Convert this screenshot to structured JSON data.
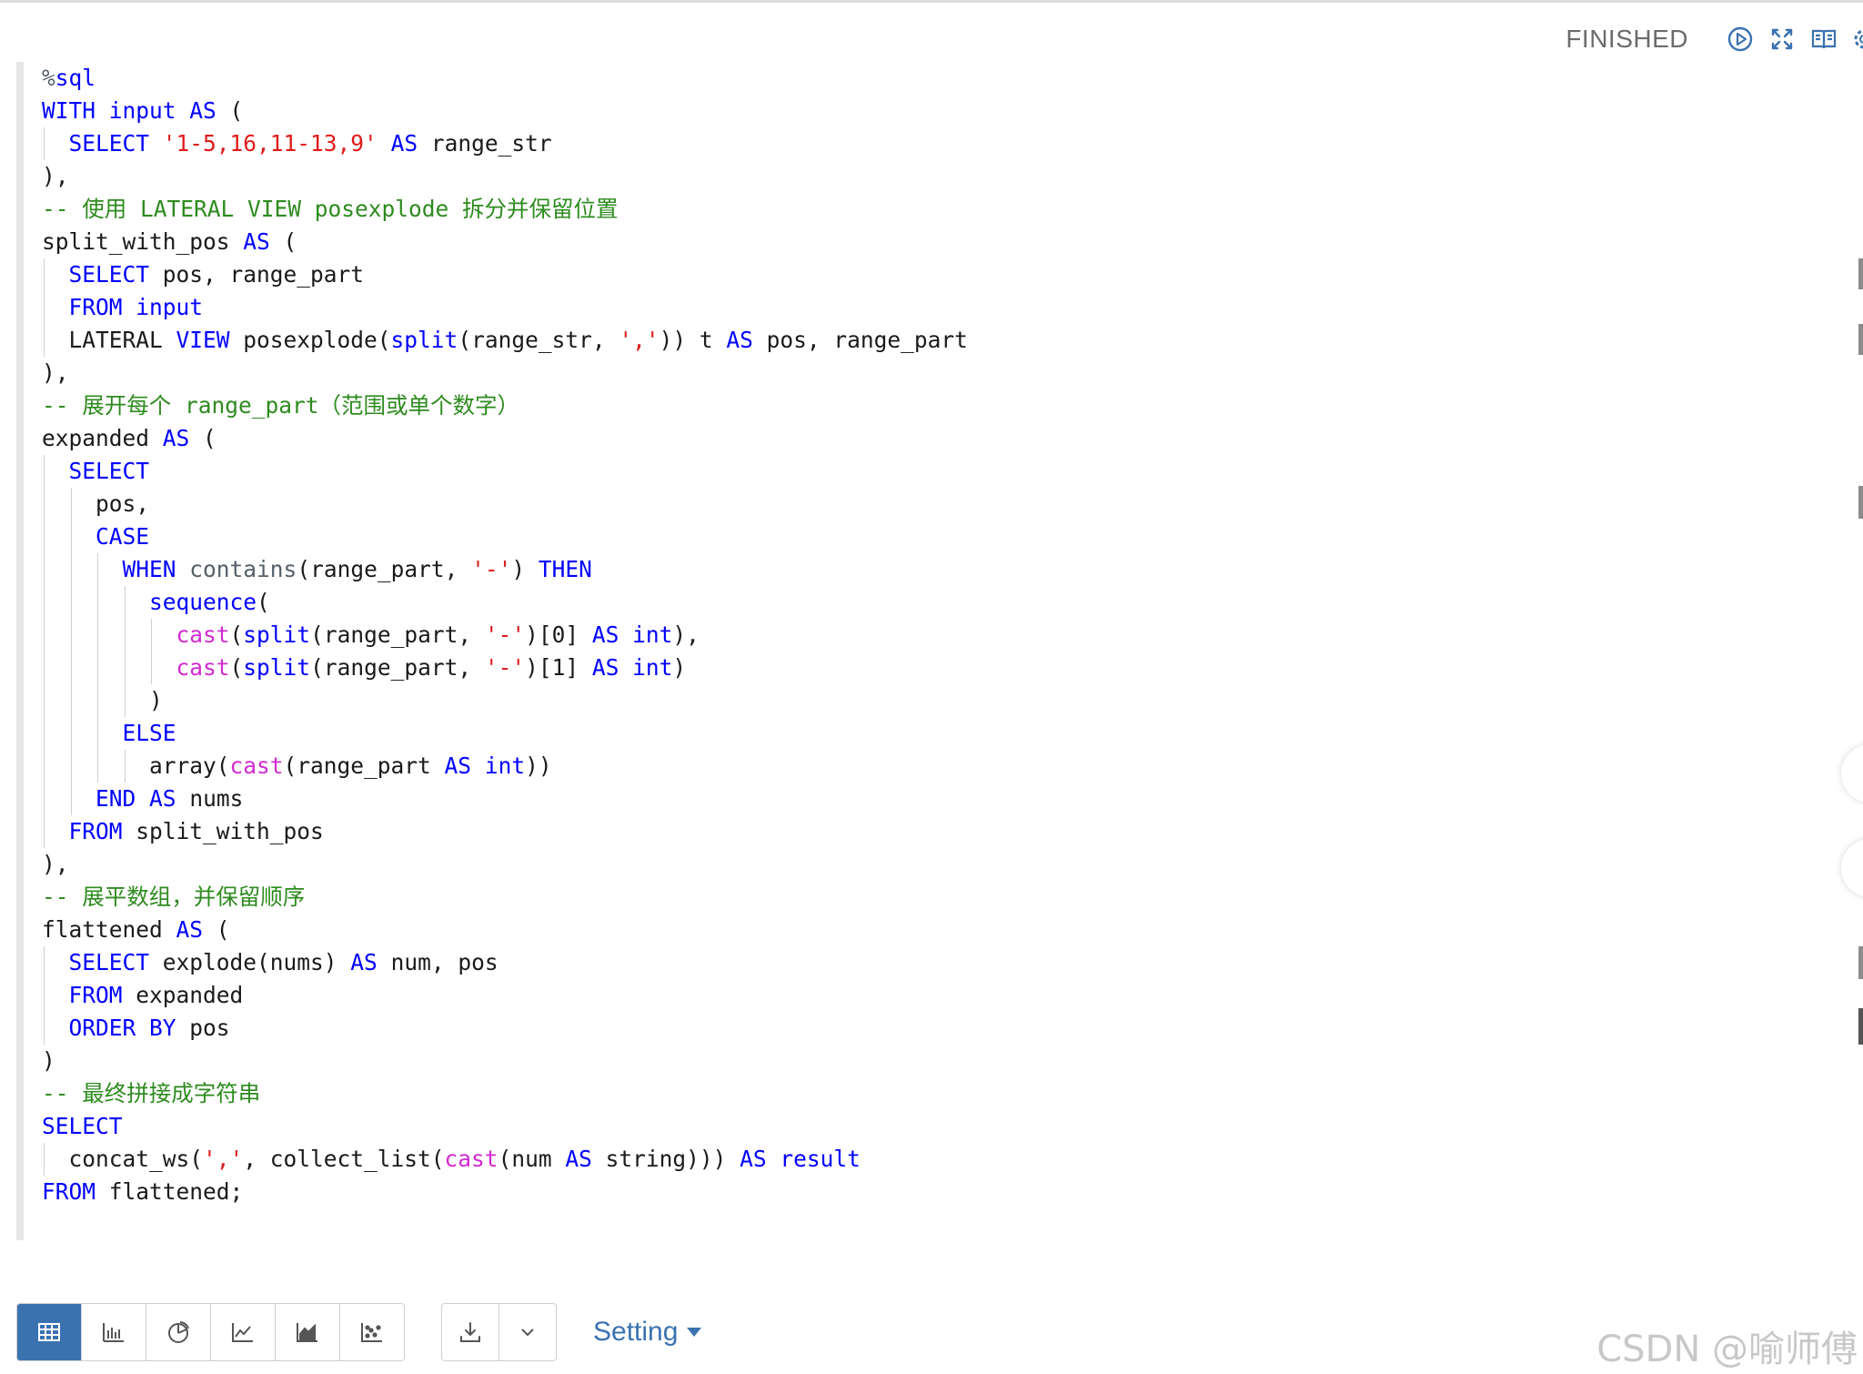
{
  "paragraph": {
    "status": "FINISHED",
    "header_icons": [
      "run-icon",
      "expand-icon",
      "book-icon",
      "settings-icon"
    ]
  },
  "code_lines": [
    [
      {
        "t": "%",
        "c": "gr"
      },
      {
        "t": "sql",
        "c": "kw"
      }
    ],
    [
      {
        "t": "WITH input AS",
        "c": "kw"
      },
      {
        "t": " ("
      }
    ],
    [
      {
        "t": "  "
      },
      {
        "t": "SELECT",
        "c": "kw"
      },
      {
        "t": " "
      },
      {
        "t": "'1-5,16,11-13,9'",
        "c": "str"
      },
      {
        "t": " "
      },
      {
        "t": "AS",
        "c": "kw"
      },
      {
        "t": " range_str"
      }
    ],
    [
      {
        "t": "),"
      }
    ],
    [
      {
        "t": "-- 使用 LATERAL VIEW posexplode 拆分并保留位置",
        "c": "cm"
      }
    ],
    [
      {
        "t": "split_with_pos "
      },
      {
        "t": "AS",
        "c": "kw"
      },
      {
        "t": " ("
      }
    ],
    [
      {
        "t": "  "
      },
      {
        "t": "SELECT",
        "c": "kw"
      },
      {
        "t": " pos, range_part"
      }
    ],
    [
      {
        "t": "  "
      },
      {
        "t": "FROM input",
        "c": "kw"
      }
    ],
    [
      {
        "t": "  LATERAL "
      },
      {
        "t": "VIEW",
        "c": "kw"
      },
      {
        "t": " posexplode("
      },
      {
        "t": "split",
        "c": "kw"
      },
      {
        "t": "(range_str, "
      },
      {
        "t": "','",
        "c": "str"
      },
      {
        "t": ")) t "
      },
      {
        "t": "AS",
        "c": "kw"
      },
      {
        "t": " pos, range_part"
      }
    ],
    [
      {
        "t": "),"
      }
    ],
    [
      {
        "t": "-- 展开每个 range_part（范围或单个数字）",
        "c": "cm"
      }
    ],
    [
      {
        "t": "expanded "
      },
      {
        "t": "AS",
        "c": "kw"
      },
      {
        "t": " ("
      }
    ],
    [
      {
        "t": "  "
      },
      {
        "t": "SELECT",
        "c": "kw"
      }
    ],
    [
      {
        "t": "    pos,"
      }
    ],
    [
      {
        "t": "    "
      },
      {
        "t": "CASE",
        "c": "kw"
      }
    ],
    [
      {
        "t": "      "
      },
      {
        "t": "WHEN",
        "c": "kw"
      },
      {
        "t": " "
      },
      {
        "t": "contains",
        "c": "gr"
      },
      {
        "t": "(range_part, "
      },
      {
        "t": "'-'",
        "c": "str"
      },
      {
        "t": ") "
      },
      {
        "t": "THEN",
        "c": "kw"
      }
    ],
    [
      {
        "t": "        "
      },
      {
        "t": "sequence",
        "c": "kw"
      },
      {
        "t": "("
      }
    ],
    [
      {
        "t": "          "
      },
      {
        "t": "cast",
        "c": "fn"
      },
      {
        "t": "("
      },
      {
        "t": "split",
        "c": "kw"
      },
      {
        "t": "(range_part, "
      },
      {
        "t": "'-'",
        "c": "str"
      },
      {
        "t": ")[0] "
      },
      {
        "t": "AS",
        "c": "kw"
      },
      {
        "t": " "
      },
      {
        "t": "int",
        "c": "kw"
      },
      {
        "t": "),"
      }
    ],
    [
      {
        "t": "          "
      },
      {
        "t": "cast",
        "c": "fn"
      },
      {
        "t": "("
      },
      {
        "t": "split",
        "c": "kw"
      },
      {
        "t": "(range_part, "
      },
      {
        "t": "'-'",
        "c": "str"
      },
      {
        "t": ")[1] "
      },
      {
        "t": "AS",
        "c": "kw"
      },
      {
        "t": " "
      },
      {
        "t": "int",
        "c": "kw"
      },
      {
        "t": ")"
      }
    ],
    [
      {
        "t": "        )"
      }
    ],
    [
      {
        "t": "      "
      },
      {
        "t": "ELSE",
        "c": "kw"
      }
    ],
    [
      {
        "t": "        array("
      },
      {
        "t": "cast",
        "c": "fn"
      },
      {
        "t": "(range_part "
      },
      {
        "t": "AS",
        "c": "kw"
      },
      {
        "t": " "
      },
      {
        "t": "int",
        "c": "kw"
      },
      {
        "t": "))"
      }
    ],
    [
      {
        "t": "    "
      },
      {
        "t": "END",
        "c": "kw"
      },
      {
        "t": " "
      },
      {
        "t": "AS",
        "c": "kw"
      },
      {
        "t": " nums"
      }
    ],
    [
      {
        "t": "  "
      },
      {
        "t": "FROM",
        "c": "kw"
      },
      {
        "t": " split_with_pos"
      }
    ],
    [
      {
        "t": "),"
      }
    ],
    [
      {
        "t": "-- 展平数组，并保留顺序",
        "c": "cm"
      }
    ],
    [
      {
        "t": "flattened "
      },
      {
        "t": "AS",
        "c": "kw"
      },
      {
        "t": " ("
      }
    ],
    [
      {
        "t": "  "
      },
      {
        "t": "SELECT",
        "c": "kw"
      },
      {
        "t": " explode(nums) "
      },
      {
        "t": "AS",
        "c": "kw"
      },
      {
        "t": " num, pos"
      }
    ],
    [
      {
        "t": "  "
      },
      {
        "t": "FROM",
        "c": "kw"
      },
      {
        "t": " expanded"
      }
    ],
    [
      {
        "t": "  "
      },
      {
        "t": "ORDER BY",
        "c": "kw"
      },
      {
        "t": " pos"
      }
    ],
    [
      {
        "t": ")"
      }
    ],
    [
      {
        "t": "-- 最终拼接成字符串",
        "c": "cm"
      }
    ],
    [
      {
        "t": "SELECT",
        "c": "kw"
      }
    ],
    [
      {
        "t": "  concat_ws("
      },
      {
        "t": "','",
        "c": "str"
      },
      {
        "t": ", collect_list("
      },
      {
        "t": "cast",
        "c": "fn"
      },
      {
        "t": "(num "
      },
      {
        "t": "AS",
        "c": "kw"
      },
      {
        "t": " string))) "
      },
      {
        "t": "AS result",
        "c": "kw"
      }
    ],
    [
      {
        "t": "FROM",
        "c": "kw"
      },
      {
        "t": " flattened;"
      }
    ]
  ],
  "toolbar": {
    "view_buttons": [
      {
        "name": "table-view-button",
        "icon": "table-icon",
        "active": true
      },
      {
        "name": "bar-chart-button",
        "icon": "bar-chart-icon",
        "active": false
      },
      {
        "name": "pie-chart-button",
        "icon": "pie-chart-icon",
        "active": false
      },
      {
        "name": "line-chart-button",
        "icon": "line-chart-icon",
        "active": false
      },
      {
        "name": "area-chart-button",
        "icon": "area-chart-icon",
        "active": false
      },
      {
        "name": "scatter-chart-button",
        "icon": "scatter-chart-icon",
        "active": false
      }
    ],
    "download_icon": "download-icon",
    "dropdown_icon": "chevron-down-icon",
    "setting_label": "Setting"
  },
  "watermark": "CSDN @喻师傅",
  "colors": {
    "accent": "#3a72b0",
    "keyword": "#0000ff",
    "string": "#e01b1b",
    "comment": "#2e8b1f",
    "function": "#d12bd1"
  }
}
